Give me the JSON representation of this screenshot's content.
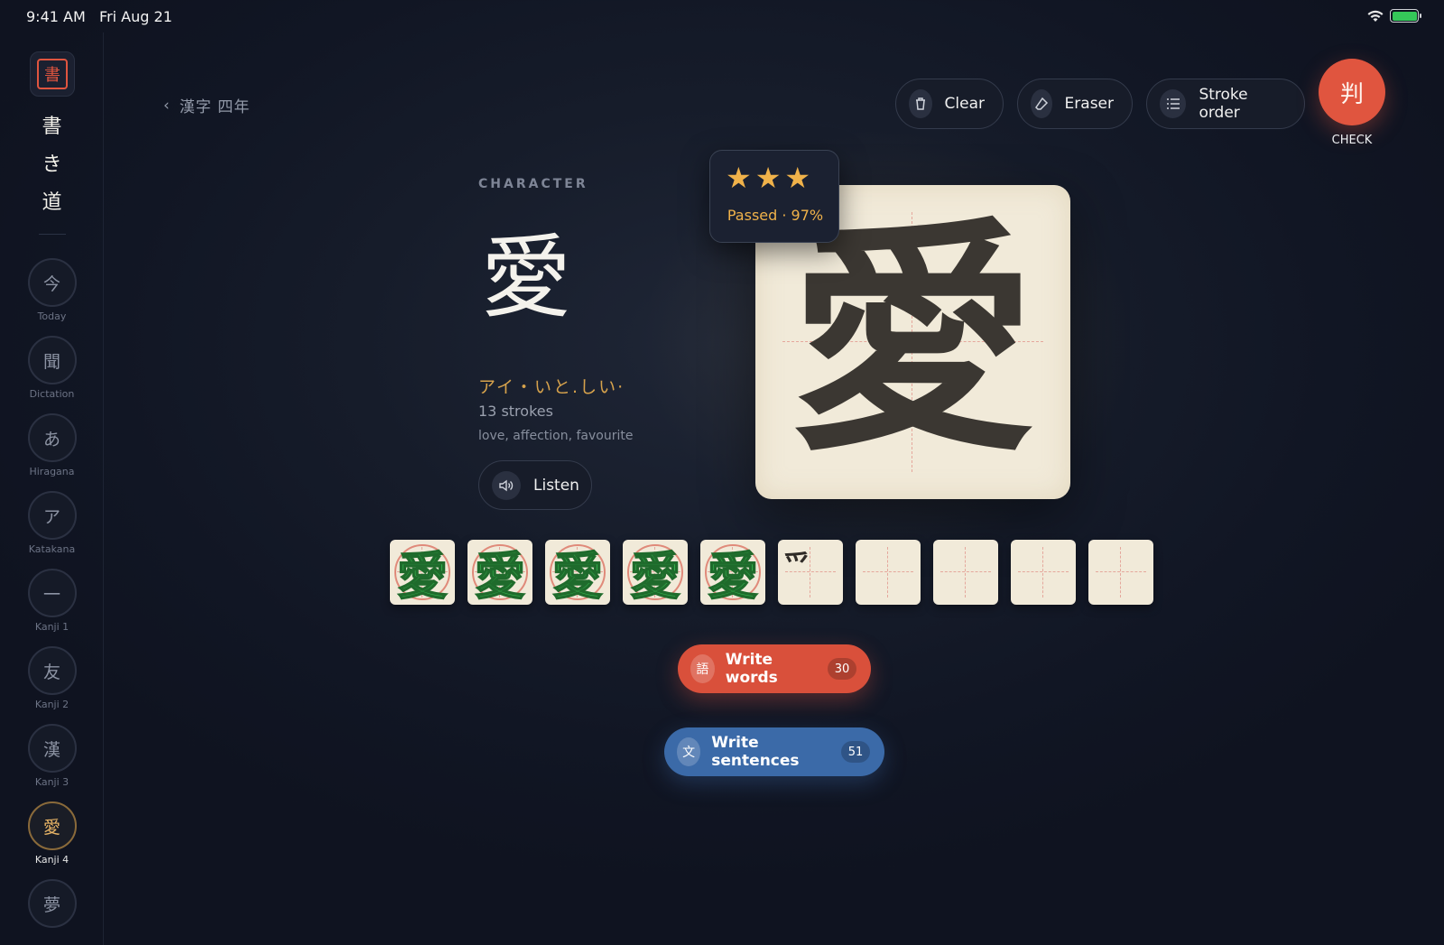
{
  "status": {
    "time": "9:41 AM",
    "date": "Fri Aug 21"
  },
  "app": {
    "logo_char": "書",
    "title_chars": [
      "書",
      "き",
      "道"
    ]
  },
  "sidebar": {
    "items": [
      {
        "char": "今",
        "label": "Today",
        "active": false
      },
      {
        "char": "聞",
        "label": "Dictation",
        "active": false
      },
      {
        "char": "あ",
        "label": "Hiragana",
        "active": false
      },
      {
        "char": "ア",
        "label": "Katakana",
        "active": false
      },
      {
        "char": "一",
        "label": "Kanji 1",
        "active": false
      },
      {
        "char": "友",
        "label": "Kanji 2",
        "active": false
      },
      {
        "char": "漢",
        "label": "Kanji 3",
        "active": false
      },
      {
        "char": "愛",
        "label": "Kanji 4",
        "active": true
      },
      {
        "char": "夢",
        "label": "",
        "active": false
      }
    ]
  },
  "header": {
    "back_label": "漢字 四年"
  },
  "toolbar": {
    "clear_label": "Clear",
    "eraser_label": "Eraser",
    "stroke_order_label": "Stroke order",
    "check_char": "判",
    "check_label": "CHECK"
  },
  "character": {
    "caption": "CHARACTER",
    "kanji": "愛",
    "reading": "アイ・いと.しい·",
    "strokes": "13 strokes",
    "meaning": "love, affection, favourite",
    "listen_label": "Listen"
  },
  "result": {
    "stars": 3,
    "text": "Passed · 97%"
  },
  "practice": {
    "cells": [
      {
        "state": "passed",
        "char": "愛"
      },
      {
        "state": "passed",
        "char": "愛"
      },
      {
        "state": "passed",
        "char": "愛"
      },
      {
        "state": "passed",
        "char": "愛"
      },
      {
        "state": "passed",
        "char": "愛"
      },
      {
        "state": "in-progress",
        "char": "爫"
      },
      {
        "state": "empty",
        "char": ""
      },
      {
        "state": "empty",
        "char": ""
      },
      {
        "state": "empty",
        "char": ""
      },
      {
        "state": "empty",
        "char": ""
      }
    ]
  },
  "actions": {
    "write_words": {
      "icon_char": "語",
      "label": "Write words",
      "count": "30"
    },
    "write_sentences": {
      "icon_char": "文",
      "label": "Write sentences",
      "count": "51"
    }
  },
  "colors": {
    "accent_red": "#e0553f",
    "accent_blue": "#3b6aa8",
    "gold": "#f0b24a",
    "paper": "#f1ead9"
  }
}
